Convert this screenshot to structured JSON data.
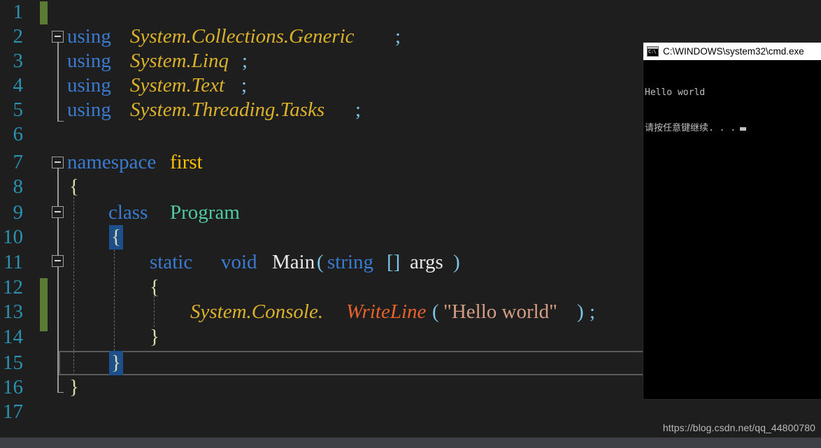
{
  "editor": {
    "language": "csharp",
    "background": "#1e1e1e",
    "line_number_color": "#2b91af",
    "change_marker_color": "#5a7b33",
    "current_line": 15,
    "line_numbers": [
      "1",
      "2",
      "3",
      "4",
      "5",
      "6",
      "7",
      "8",
      "9",
      "0",
      "1",
      "2",
      "3",
      "4",
      "5",
      "6",
      "7"
    ],
    "lines": [
      {
        "n": "1",
        "text": ""
      },
      {
        "n": "2",
        "text": "using System.Collections.Generic;"
      },
      {
        "n": "3",
        "text": "using System.Linq;"
      },
      {
        "n": "4",
        "text": "using System.Text;"
      },
      {
        "n": "5",
        "text": "using System.Threading.Tasks;"
      },
      {
        "n": "6",
        "text": ""
      },
      {
        "n": "7",
        "text": "namespace first"
      },
      {
        "n": "8",
        "text": "{"
      },
      {
        "n": "9",
        "text": "    class Program"
      },
      {
        "n": "10",
        "text": "    {"
      },
      {
        "n": "11",
        "text": "        static void Main(string[] args)"
      },
      {
        "n": "12",
        "text": "        {"
      },
      {
        "n": "13",
        "text": "            System.Console.WriteLine(\"Hello world\");"
      },
      {
        "n": "14",
        "text": "        }"
      },
      {
        "n": "15",
        "text": "    }"
      },
      {
        "n": "16",
        "text": "}"
      },
      {
        "n": "17",
        "text": ""
      }
    ],
    "tokens": {
      "kw_using": "using",
      "kw_namespace": "namespace",
      "kw_class": "class",
      "kw_static": "static",
      "kw_void": "void",
      "kw_string": "string",
      "ns_collections": "System.Collections.Generic",
      "ns_linq": "System.Linq",
      "ns_text": "System.Text",
      "ns_threading": "System.Threading.Tasks",
      "name_first": "first",
      "name_program": "Program",
      "name_main": "Main",
      "name_args": "args",
      "ns_sysconsole": "System.Console.",
      "method_writeline": "WriteLine",
      "string_literal": "\"Hello world\"",
      "semicolon": ";",
      "brackets": "[]",
      "paren_open": "(",
      "paren_close": ")",
      "brace_open": "{",
      "brace_close": "}"
    },
    "colors": {
      "keyword": "#3a7bd0",
      "namespace": "#dcb12a",
      "type": "#4ec9a0",
      "namespace_name": "#ffc000",
      "method": "#e8622a",
      "string": "#d69d85",
      "punctuation": "#7cc4e8",
      "plain": "#e8e8e8",
      "brace": "#dcdcaa",
      "selection": "#1d4f8c"
    }
  },
  "console_window": {
    "title": "C:\\WINDOWS\\system32\\cmd.exe",
    "icon": "cmd-icon",
    "icon_text": "C:\\",
    "output": [
      "Hello world",
      "请按任意键继续. . ."
    ],
    "cursor": "block",
    "background": "#000000",
    "text_color": "#c0c0c0"
  },
  "watermark": {
    "text": "https://blog.csdn.net/qq_44800780"
  },
  "bottom_bar": {
    "color": "#3f3f46"
  }
}
